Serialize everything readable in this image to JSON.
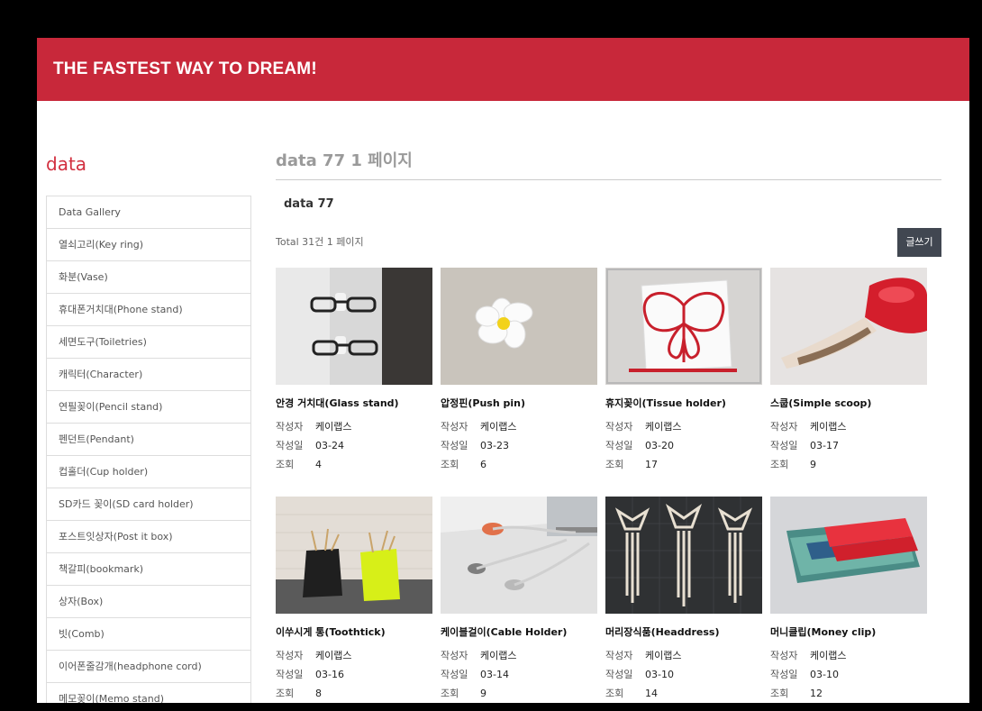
{
  "header": {
    "brand": "THE FASTEST WAY TO DREAM!"
  },
  "sidebar": {
    "title": "data",
    "items": [
      "Data Gallery",
      "열쇠고리(Key ring)",
      "화분(Vase)",
      "휴대폰거치대(Phone stand)",
      "세면도구(Toiletries)",
      "캐릭터(Character)",
      "연필꽂이(Pencil stand)",
      "펜던트(Pendant)",
      "컵홀더(Cup holder)",
      "SD카드 꽂이(SD card holder)",
      "포스트잇상자(Post it box)",
      "책갈피(bookmark)",
      "상자(Box)",
      "빗(Comb)",
      "이어폰줄감개(headphone cord)",
      "메모꽂이(Memo stand)"
    ]
  },
  "main": {
    "page_heading": "data 77 1 페이지",
    "board_title": "data 77",
    "total_text": "Total 31건 1 페이지",
    "write_button": "글쓰기",
    "labels": {
      "author": "작성자",
      "date": "작성일",
      "views": "조회"
    },
    "posts": [
      {
        "title": "안경 거치대(Glass stand)",
        "author": "케이랩스",
        "date": "03-24",
        "views": "4"
      },
      {
        "title": "압정핀(Push pin)",
        "author": "케이랩스",
        "date": "03-23",
        "views": "6"
      },
      {
        "title": "휴지꽂이(Tissue holder)",
        "author": "케이랩스",
        "date": "03-20",
        "views": "17"
      },
      {
        "title": "스쿱(Simple scoop)",
        "author": "케이랩스",
        "date": "03-17",
        "views": "9"
      },
      {
        "title": "이쑤시게 통(Toothtick)",
        "author": "케이랩스",
        "date": "03-16",
        "views": "8"
      },
      {
        "title": "케이블걸이(Cable Holder)",
        "author": "케이랩스",
        "date": "03-14",
        "views": "9"
      },
      {
        "title": "머리장식품(Headdress)",
        "author": "케이랩스",
        "date": "03-10",
        "views": "14"
      },
      {
        "title": "머니클립(Money clip)",
        "author": "케이랩스",
        "date": "03-10",
        "views": "12"
      }
    ]
  },
  "colors": {
    "header_bg": "#c8283a",
    "accent": "#d22f3f",
    "button_bg": "#414751"
  }
}
